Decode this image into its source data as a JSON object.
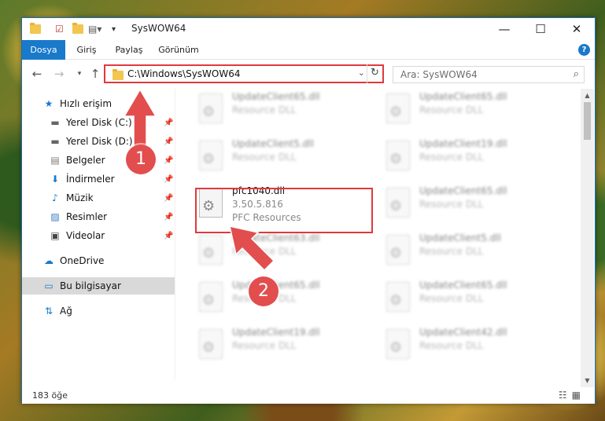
{
  "window": {
    "title": "SysWOW64",
    "minimize": "—",
    "maximize": "☐",
    "close": "✕"
  },
  "ribbon": {
    "tabs": [
      "Dosya",
      "Giriş",
      "Paylaş",
      "Görünüm"
    ],
    "help": "?"
  },
  "address": {
    "path": "C:\\Windows\\SysWOW64",
    "search_placeholder": "Ara: SysWOW64"
  },
  "sidebar": {
    "items": [
      {
        "label": "Hızlı erişim"
      },
      {
        "label": "Yerel Disk (C:)"
      },
      {
        "label": "Yerel Disk (D:)"
      },
      {
        "label": "Belgeler"
      },
      {
        "label": "İndirmeler"
      },
      {
        "label": "Müzik"
      },
      {
        "label": "Resimler"
      },
      {
        "label": "Videolar"
      },
      {
        "label": "OneDrive"
      },
      {
        "label": "Bu bilgisayar"
      },
      {
        "label": "Ağ"
      }
    ]
  },
  "files": [
    {
      "name": "UpdateClient65.dll",
      "desc": "Resource DLL"
    },
    {
      "name": "UpdateClient65.dll",
      "desc": "Resource DLL"
    },
    {
      "name": "UpdateClient5.dll",
      "desc": "Resource DLL"
    },
    {
      "name": "UpdateClient19.dll",
      "desc": "Resource DLL"
    },
    {
      "name": "pfc1040.dll",
      "desc": "3.50.5.816",
      "extra": "PFC Resources"
    },
    {
      "name": "UpdateClient65.dll",
      "desc": "Resource DLL"
    },
    {
      "name": "UpdateClient63.dll",
      "desc": "Resource DLL"
    },
    {
      "name": "UpdateClient5.dll",
      "desc": "Resource DLL"
    },
    {
      "name": "UpdateClient65.dll",
      "desc": "Resource DLL"
    },
    {
      "name": "UpdateClient65.dll",
      "desc": "Resource DLL"
    },
    {
      "name": "UpdateClient19.dll",
      "desc": "Resource DLL"
    },
    {
      "name": "UpdateClient42.dll",
      "desc": "Resource DLL"
    }
  ],
  "status": {
    "count": "183 öğe"
  },
  "annotations": {
    "step1": "1",
    "step2": "2",
    "color": "#e0393e"
  }
}
